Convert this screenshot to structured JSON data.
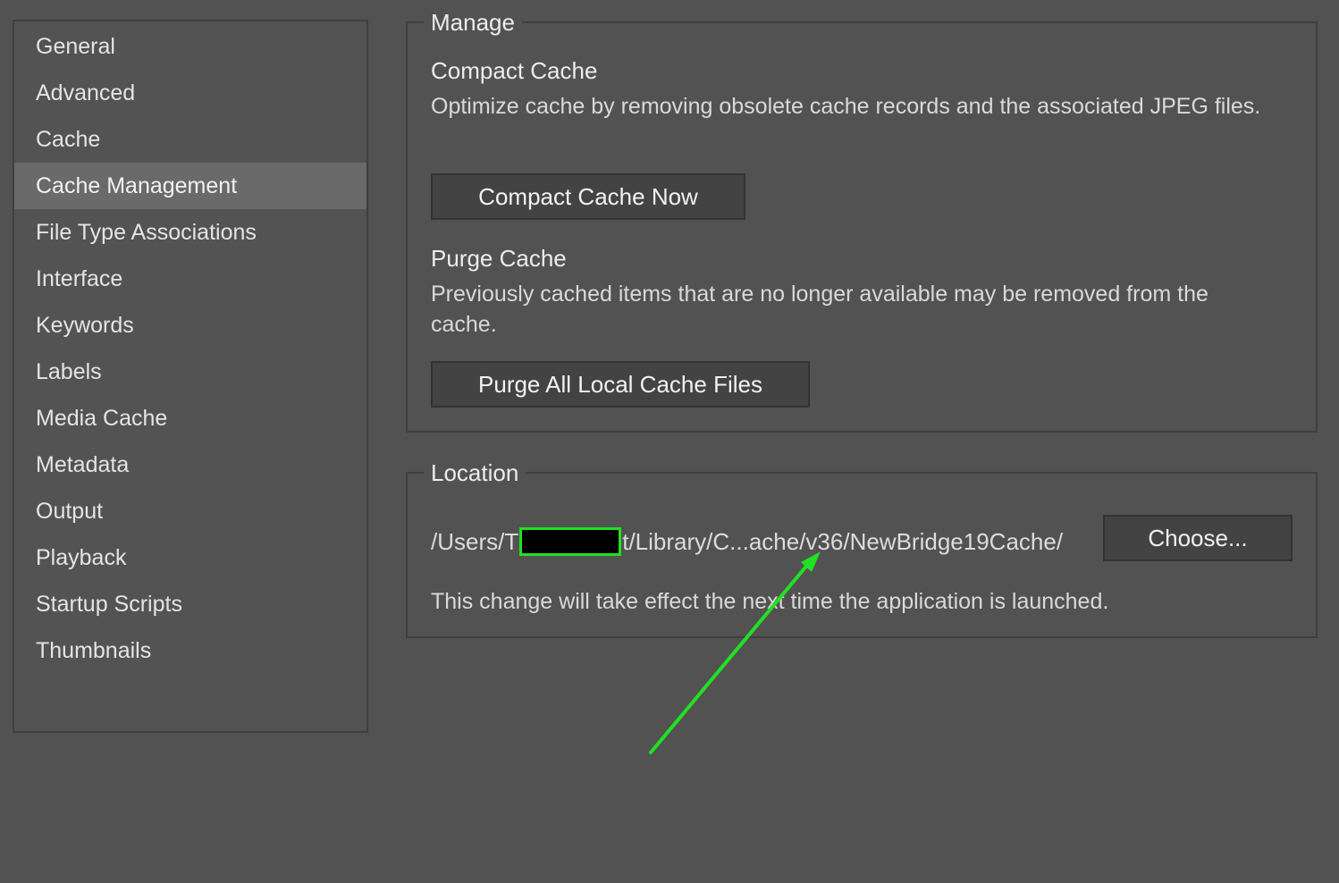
{
  "sidebar": {
    "items": [
      {
        "label": "General",
        "selected": false
      },
      {
        "label": "Advanced",
        "selected": false
      },
      {
        "label": "Cache",
        "selected": false
      },
      {
        "label": "Cache Management",
        "selected": true
      },
      {
        "label": "File Type Associations",
        "selected": false
      },
      {
        "label": "Interface",
        "selected": false
      },
      {
        "label": "Keywords",
        "selected": false
      },
      {
        "label": "Labels",
        "selected": false
      },
      {
        "label": "Media Cache",
        "selected": false
      },
      {
        "label": "Metadata",
        "selected": false
      },
      {
        "label": "Output",
        "selected": false
      },
      {
        "label": "Playback",
        "selected": false
      },
      {
        "label": "Startup Scripts",
        "selected": false
      },
      {
        "label": "Thumbnails",
        "selected": false
      }
    ]
  },
  "manage": {
    "legend": "Manage",
    "compact_heading": "Compact Cache",
    "compact_desc": "Optimize cache by removing obsolete cache records and the associated JPEG files.",
    "compact_button": "Compact Cache Now",
    "purge_heading": "Purge Cache",
    "purge_desc": "Previously cached items that are no longer available may be removed from the cache.",
    "purge_button": "Purge All Local Cache Files"
  },
  "location": {
    "legend": "Location",
    "path_prefix": "/Users/T",
    "path_suffix": "t/Library/C...ache/v36/NewBridge19Cache/",
    "choose_button": "Choose...",
    "note": "This change will take effect the next time the application is launched."
  },
  "colors": {
    "annotation_arrow": "#22e022",
    "background": "#525252",
    "selected_item": "#6a6a6a"
  }
}
